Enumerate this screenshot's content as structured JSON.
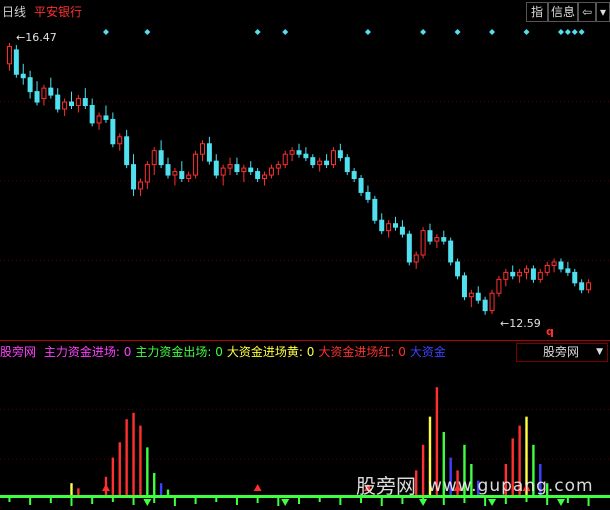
{
  "topbar": {
    "period": "日线",
    "stock_name": "平安银行",
    "btn_zhi": "指",
    "btn_info": "信息",
    "btn_back": "⇦",
    "btn_close": "▾"
  },
  "main_chart": {
    "high_label": "16.47",
    "low_label": "12.59",
    "marker": "q",
    "up_color": "#ff3030",
    "down_color": "#50e0f0"
  },
  "indicator": {
    "name": "股旁网",
    "items": [
      {
        "label": "主力资金进场:",
        "value": "0",
        "color": "#ff40ff"
      },
      {
        "label": "主力资金出场:",
        "value": "0",
        "color": "#40ff40"
      },
      {
        "label": "大资金进场黄:",
        "value": "0",
        "color": "#ffff40"
      },
      {
        "label": "大资金进场红:",
        "value": "0",
        "color": "#ff3030"
      },
      {
        "label": "大资金",
        "value": "",
        "color": "#4040ff"
      }
    ],
    "selector_label": "股旁网"
  },
  "watermark": {
    "left": "股旁网",
    "right": "www.gupang.com"
  },
  "chart_data": {
    "type": "candlestick",
    "price_range": [
      12.4,
      16.6
    ],
    "candles": [
      [
        16.2,
        16.5,
        16.1,
        16.45
      ],
      [
        16.4,
        16.47,
        16.0,
        16.05
      ],
      [
        16.05,
        16.2,
        15.9,
        16.0
      ],
      [
        16.0,
        16.1,
        15.7,
        15.8
      ],
      [
        15.8,
        15.95,
        15.6,
        15.65
      ],
      [
        15.7,
        15.9,
        15.6,
        15.85
      ],
      [
        15.85,
        16.0,
        15.7,
        15.75
      ],
      [
        15.75,
        15.85,
        15.5,
        15.55
      ],
      [
        15.55,
        15.7,
        15.45,
        15.65
      ],
      [
        15.65,
        15.8,
        15.55,
        15.6
      ],
      [
        15.6,
        15.75,
        15.5,
        15.7
      ],
      [
        15.7,
        15.85,
        15.55,
        15.6
      ],
      [
        15.6,
        15.7,
        15.3,
        15.35
      ],
      [
        15.35,
        15.5,
        15.25,
        15.45
      ],
      [
        15.45,
        15.6,
        15.35,
        15.4
      ],
      [
        15.4,
        15.5,
        15.0,
        15.05
      ],
      [
        15.05,
        15.2,
        14.95,
        15.15
      ],
      [
        15.15,
        15.25,
        14.7,
        14.75
      ],
      [
        14.75,
        14.9,
        14.3,
        14.4
      ],
      [
        14.4,
        14.55,
        14.3,
        14.5
      ],
      [
        14.5,
        14.8,
        14.4,
        14.75
      ],
      [
        14.75,
        15.0,
        14.6,
        14.95
      ],
      [
        14.95,
        15.1,
        14.7,
        14.75
      ],
      [
        14.75,
        14.85,
        14.55,
        14.6
      ],
      [
        14.6,
        14.7,
        14.45,
        14.65
      ],
      [
        14.65,
        14.8,
        14.5,
        14.55
      ],
      [
        14.55,
        14.65,
        14.5,
        14.6
      ],
      [
        14.6,
        14.95,
        14.55,
        14.9
      ],
      [
        14.9,
        15.1,
        14.8,
        15.05
      ],
      [
        15.05,
        15.15,
        14.75,
        14.8
      ],
      [
        14.8,
        14.9,
        14.55,
        14.6
      ],
      [
        14.6,
        14.75,
        14.45,
        14.7
      ],
      [
        14.7,
        14.85,
        14.6,
        14.75
      ],
      [
        14.75,
        14.85,
        14.6,
        14.65
      ],
      [
        14.65,
        14.75,
        14.5,
        14.7
      ],
      [
        14.7,
        14.8,
        14.6,
        14.65
      ],
      [
        14.65,
        14.7,
        14.5,
        14.55
      ],
      [
        14.55,
        14.65,
        14.45,
        14.6
      ],
      [
        14.6,
        14.75,
        14.55,
        14.7
      ],
      [
        14.7,
        14.8,
        14.6,
        14.75
      ],
      [
        14.75,
        14.95,
        14.7,
        14.9
      ],
      [
        14.9,
        15.0,
        14.8,
        14.95
      ],
      [
        14.95,
        15.05,
        14.85,
        14.9
      ],
      [
        14.9,
        15.0,
        14.8,
        14.85
      ],
      [
        14.85,
        14.9,
        14.7,
        14.75
      ],
      [
        14.75,
        14.85,
        14.65,
        14.8
      ],
      [
        14.8,
        14.9,
        14.7,
        14.75
      ],
      [
        14.75,
        15.0,
        14.7,
        14.95
      ],
      [
        14.95,
        15.05,
        14.8,
        14.85
      ],
      [
        14.85,
        14.9,
        14.6,
        14.65
      ],
      [
        14.65,
        14.7,
        14.5,
        14.55
      ],
      [
        14.55,
        14.6,
        14.3,
        14.35
      ],
      [
        14.35,
        14.45,
        14.2,
        14.25
      ],
      [
        14.25,
        14.3,
        13.9,
        13.95
      ],
      [
        13.95,
        14.05,
        13.75,
        13.8
      ],
      [
        13.8,
        13.95,
        13.7,
        13.9
      ],
      [
        13.9,
        14.0,
        13.8,
        13.85
      ],
      [
        13.85,
        13.95,
        13.7,
        13.75
      ],
      [
        13.75,
        13.8,
        13.3,
        13.35
      ],
      [
        13.35,
        13.5,
        13.25,
        13.45
      ],
      [
        13.45,
        13.85,
        13.4,
        13.8
      ],
      [
        13.8,
        13.9,
        13.6,
        13.65
      ],
      [
        13.65,
        13.75,
        13.55,
        13.7
      ],
      [
        13.7,
        13.8,
        13.6,
        13.65
      ],
      [
        13.65,
        13.7,
        13.3,
        13.35
      ],
      [
        13.35,
        13.4,
        13.1,
        13.15
      ],
      [
        13.15,
        13.2,
        12.8,
        12.85
      ],
      [
        12.85,
        12.95,
        12.7,
        12.9
      ],
      [
        12.9,
        13.0,
        12.75,
        12.8
      ],
      [
        12.8,
        12.85,
        12.59,
        12.65
      ],
      [
        12.65,
        12.95,
        12.6,
        12.9
      ],
      [
        12.9,
        13.15,
        12.85,
        13.1
      ],
      [
        13.1,
        13.25,
        13.0,
        13.2
      ],
      [
        13.2,
        13.3,
        13.1,
        13.15
      ],
      [
        13.15,
        13.25,
        13.05,
        13.2
      ],
      [
        13.2,
        13.3,
        13.1,
        13.25
      ],
      [
        13.25,
        13.3,
        13.05,
        13.1
      ],
      [
        13.1,
        13.25,
        13.05,
        13.2
      ],
      [
        13.2,
        13.35,
        13.15,
        13.3
      ],
      [
        13.3,
        13.4,
        13.2,
        13.35
      ],
      [
        13.35,
        13.4,
        13.2,
        13.25
      ],
      [
        13.25,
        13.35,
        13.15,
        13.2
      ],
      [
        13.2,
        13.25,
        13.0,
        13.05
      ],
      [
        13.05,
        13.1,
        12.9,
        12.95
      ],
      [
        12.95,
        13.1,
        12.9,
        13.05
      ]
    ],
    "signal_markers": [
      14,
      20,
      36,
      40,
      52,
      60,
      65,
      70,
      75,
      80
    ],
    "indicator_bars": [
      {
        "i": 9,
        "h": 0.1,
        "c": "#ffff40"
      },
      {
        "i": 10,
        "h": 0.06,
        "c": "#ff3030"
      },
      {
        "i": 14,
        "h": 0.15,
        "c": "#ff3030"
      },
      {
        "i": 15,
        "h": 0.3,
        "c": "#ff3030"
      },
      {
        "i": 16,
        "h": 0.42,
        "c": "#ff3030"
      },
      {
        "i": 17,
        "h": 0.6,
        "c": "#ff3030"
      },
      {
        "i": 18,
        "h": 0.65,
        "c": "#ff3030"
      },
      {
        "i": 19,
        "h": 0.55,
        "c": "#ff3030"
      },
      {
        "i": 20,
        "h": 0.38,
        "c": "#40ff40"
      },
      {
        "i": 21,
        "h": 0.18,
        "c": "#40ff40"
      },
      {
        "i": 22,
        "h": 0.1,
        "c": "#4040ff"
      },
      {
        "i": 23,
        "h": 0.05,
        "c": "#40ff40"
      },
      {
        "i": 59,
        "h": 0.2,
        "c": "#ff3030"
      },
      {
        "i": 60,
        "h": 0.4,
        "c": "#ff3030"
      },
      {
        "i": 61,
        "h": 0.62,
        "c": "#ffff40"
      },
      {
        "i": 62,
        "h": 0.85,
        "c": "#ff3030"
      },
      {
        "i": 63,
        "h": 0.5,
        "c": "#40ff40"
      },
      {
        "i": 64,
        "h": 0.3,
        "c": "#4040ff"
      },
      {
        "i": 65,
        "h": 0.2,
        "c": "#ff3030"
      },
      {
        "i": 66,
        "h": 0.4,
        "c": "#40ff40"
      },
      {
        "i": 67,
        "h": 0.25,
        "c": "#40ff40"
      },
      {
        "i": 68,
        "h": 0.12,
        "c": "#4040ff"
      },
      {
        "i": 72,
        "h": 0.25,
        "c": "#ff3030"
      },
      {
        "i": 73,
        "h": 0.45,
        "c": "#ff3030"
      },
      {
        "i": 74,
        "h": 0.55,
        "c": "#ff3030"
      },
      {
        "i": 75,
        "h": 0.62,
        "c": "#ffff40"
      },
      {
        "i": 76,
        "h": 0.4,
        "c": "#40ff40"
      },
      {
        "i": 77,
        "h": 0.25,
        "c": "#4040ff"
      },
      {
        "i": 78,
        "h": 0.1,
        "c": "#40ff40"
      }
    ]
  }
}
